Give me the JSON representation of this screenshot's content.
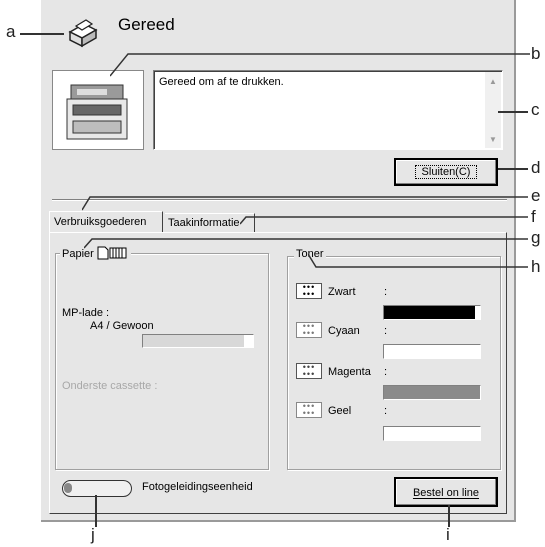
{
  "status": {
    "title": "Gereed",
    "message": "Gereed om af te drukken.",
    "close_button": "Sluiten(C)"
  },
  "tabs": [
    {
      "label": "Verbruiksgoederen",
      "active": true
    },
    {
      "label": "Taakinformatie",
      "active": false
    }
  ],
  "paper": {
    "legend": "Papier",
    "mp_tray_label": "MP-lade :",
    "mp_tray_value": "A4 / Gewoon",
    "lower_cassette_label": "Onderste cassette :"
  },
  "toner": {
    "legend": "Toner",
    "items": [
      {
        "name": "Zwart",
        "colon": ":",
        "level": 0.95,
        "color": "#000000"
      },
      {
        "name": "Cyaan",
        "colon": ":",
        "level": 0.0,
        "color": "#8a8a8a"
      },
      {
        "name": "Magenta",
        "colon": ":",
        "level": 1.0,
        "color": "#8a8a8a"
      },
      {
        "name": "Geel",
        "colon": ":",
        "level": 0.0,
        "color": "#8a8a8a"
      }
    ]
  },
  "photoconductor": {
    "label": "Fotogeleidingseenheid"
  },
  "order_button": "Bestel on line",
  "callouts": {
    "a": "a",
    "b": "b",
    "c": "c",
    "d": "d",
    "e": "e",
    "f": "f",
    "g": "g",
    "h": "h",
    "i": "i",
    "j": "j"
  }
}
